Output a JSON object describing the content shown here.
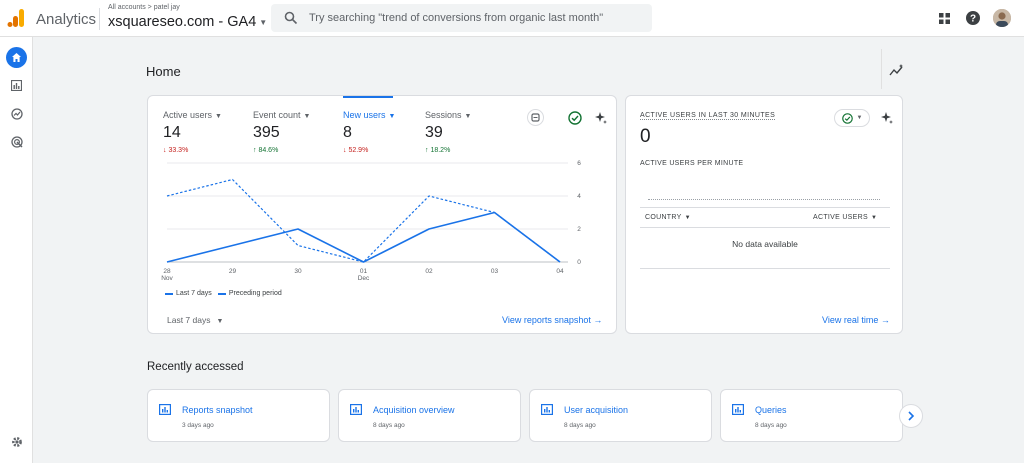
{
  "topbar": {
    "app_name": "Analytics",
    "breadcrumb": "All accounts > patel jay",
    "property": "xsquareseo.com - GA4",
    "search_placeholder": "Try searching \"trend of conversions from organic last month\"",
    "icons": [
      "analytics-logo-icon",
      "chevron-down-icon",
      "search-icon",
      "apps-grid-icon",
      "help-icon",
      "avatar"
    ],
    "brand_colors": [
      "#f9ab00",
      "#e37400"
    ]
  },
  "leftnav": {
    "items": [
      {
        "icon": "home-icon",
        "active": true
      },
      {
        "icon": "reports-icon",
        "active": false
      },
      {
        "icon": "explore-icon",
        "active": false
      },
      {
        "icon": "advertising-icon",
        "active": false
      }
    ],
    "settings_icon": "gear-icon",
    "accent": "#1a73e8"
  },
  "main": {
    "title": "Home",
    "metrics": [
      {
        "label": "Active users",
        "value": "14",
        "change": "↓ 33.3%",
        "direction": "down",
        "selected": false
      },
      {
        "label": "Event count",
        "value": "395",
        "change": "↑ 84.6%",
        "direction": "up",
        "selected": false
      },
      {
        "label": "New users",
        "value": "8",
        "change": "↓ 52.9%",
        "direction": "down",
        "selected": true
      },
      {
        "label": "Sessions",
        "value": "39",
        "change": "↑ 18.2%",
        "direction": "up",
        "selected": false
      }
    ],
    "legend": {
      "current": "Last 7 days",
      "previous": "Preceding period"
    },
    "date_range": "Last 7 days",
    "view_link": "View reports snapshot →",
    "status_colors": {
      "down": "#c5221f",
      "up": "#137333"
    }
  },
  "chart_data": {
    "type": "line",
    "title": "",
    "x": [
      "28",
      "29",
      "30",
      "01",
      "02",
      "03",
      "04"
    ],
    "x_sublabels": [
      "Nov",
      "",
      "",
      "Dec",
      "",
      "",
      ""
    ],
    "ylim": [
      0,
      6
    ],
    "yticks": [
      0,
      2,
      4,
      6
    ],
    "series": [
      {
        "name": "Last 7 days",
        "style": "solid",
        "values": [
          0,
          1,
          2,
          0,
          2,
          3,
          0
        ]
      },
      {
        "name": "Preceding period",
        "style": "dashed",
        "values": [
          4,
          5,
          1,
          0,
          4,
          3,
          0
        ]
      }
    ],
    "grid": true,
    "legend_position": "bottom-left"
  },
  "realtime": {
    "title": "ACTIVE USERS IN LAST 30 MINUTES",
    "value": "0",
    "subtitle": "ACTIVE USERS PER MINUTE",
    "col_country": "COUNTRY",
    "col_active": "ACTIVE USERS",
    "empty": "No data available",
    "view_link": "View real time →"
  },
  "recent": {
    "title": "Recently accessed",
    "items": [
      {
        "title": "Reports snapshot",
        "time": "3 days ago"
      },
      {
        "title": "Acquisition overview",
        "time": "8 days ago"
      },
      {
        "title": "User acquisition",
        "time": "8 days ago"
      },
      {
        "title": "Queries",
        "time": "8 days ago"
      }
    ]
  }
}
